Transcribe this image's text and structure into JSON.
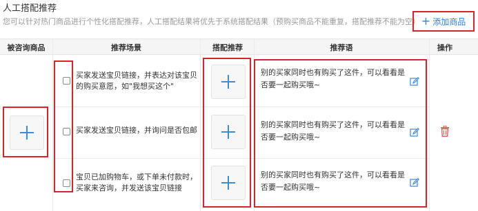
{
  "header": {
    "title": "人工搭配推荐",
    "description": "您可以针对热门商品进行个性化搭配推荐，人工搭配结果将优先于系统搭配结果（预购买商品不能重复，搭配推荐不能为空）",
    "add_button_label": "添加商品",
    "add_icon": "plus-icon"
  },
  "table": {
    "columns": [
      "被咨询商品",
      "推荐场景",
      "搭配推荐",
      "推荐语",
      "操作"
    ],
    "rows": [
      {
        "scene": "买家发送宝贝链接，并表达对该宝贝的购买意愿，如\"我想买这个\"",
        "phrase": "别的买家同时也有购买了这件，可以看看是否要一起购买哦~"
      },
      {
        "scene": "买家发送宝贝链接，并询问是否包邮",
        "phrase": "别的买家同时也有购买了这件，可以看看是否要一起购买哦~"
      },
      {
        "scene": "宝贝已加购物车，或下单未付款时，买家来咨询，并发送该宝贝链接",
        "phrase": "别的买家同时也有购买了这件，可以看看是否要一起购买哦~"
      }
    ]
  },
  "colors": {
    "highlight": "#d9222a",
    "accent": "#2d7fd6",
    "delete": "#e0524d"
  },
  "icons": {
    "edit": "edit-icon",
    "delete": "trash-icon",
    "add": "plus-icon"
  }
}
